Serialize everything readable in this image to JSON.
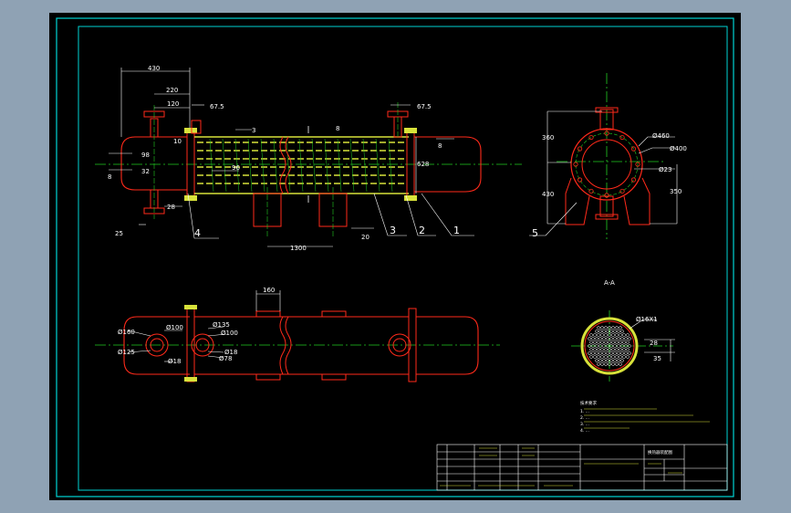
{
  "viewer": {
    "background_color": "#8fa2b4",
    "paper_color": "#000000",
    "border_color": "#00d4d4"
  },
  "drawing": {
    "colors": {
      "outline": "#ff2a1a",
      "centerline": "#22cc22",
      "tubes": "#d8e23a",
      "dimensions": "#ffffff"
    },
    "front_view_dims": [
      "430",
      "220",
      "120",
      "67.5",
      "10",
      "98",
      "32",
      "25",
      "28",
      "1300",
      "20",
      "8",
      "3",
      "96",
      "8",
      "8",
      "628",
      "67.5"
    ],
    "part_labels": [
      "1",
      "2",
      "3",
      "4",
      "5"
    ],
    "side_view_dims": [
      "360",
      "430",
      "350",
      "Ø460",
      "Ø400",
      "Ø23"
    ],
    "top_view_dims": [
      "160",
      "Ø160",
      "Ø100",
      "Ø125",
      "Ø18",
      "Ø135",
      "Ø100",
      "Ø18",
      "Ø78"
    ],
    "section": {
      "title": "A-A",
      "dims": [
        "Ø16X1",
        "28",
        "35"
      ]
    },
    "notes": {
      "title": "技术要求",
      "lines": [
        "1. ...",
        "2. ...",
        "3. ...",
        "4. ..."
      ]
    },
    "title_block": {
      "name": "换热器装配图"
    }
  }
}
